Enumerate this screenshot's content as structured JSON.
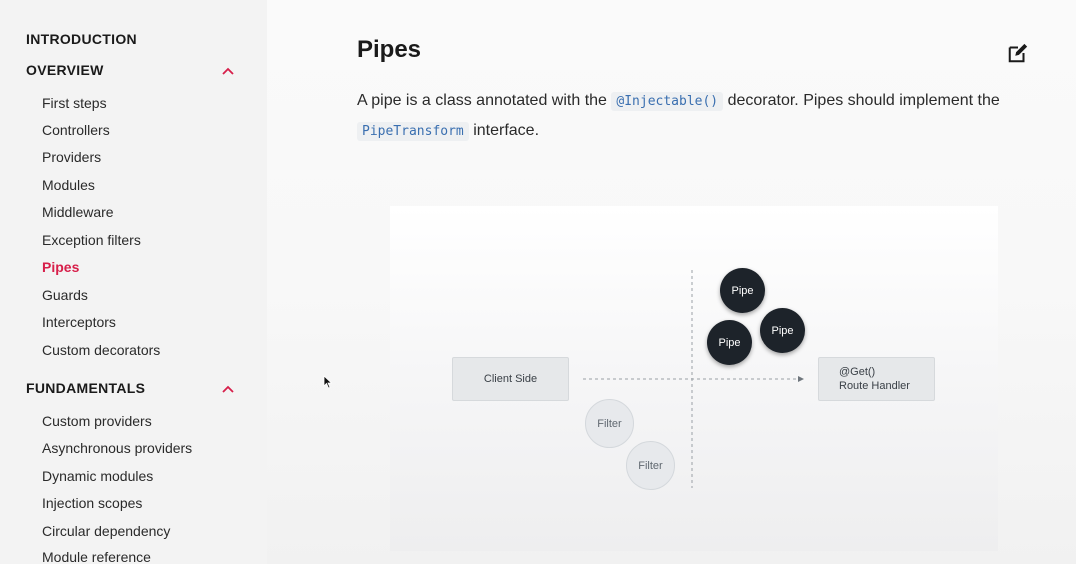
{
  "sidebar": {
    "introduction": "INTRODUCTION",
    "overview": {
      "title": "OVERVIEW",
      "items": [
        "First steps",
        "Controllers",
        "Providers",
        "Modules",
        "Middleware",
        "Exception filters",
        "Pipes",
        "Guards",
        "Interceptors",
        "Custom decorators"
      ],
      "active": "Pipes"
    },
    "fundamentals": {
      "title": "FUNDAMENTALS",
      "items": [
        "Custom providers",
        "Asynchronous providers",
        "Dynamic modules",
        "Injection scopes",
        "Circular dependency",
        "Module reference"
      ]
    }
  },
  "main": {
    "title": "Pipes",
    "desc_part1": "A pipe is a class annotated with the ",
    "code_injectable": "@Injectable()",
    "desc_part2": " decorator. Pipes should implement the ",
    "code_pipetransform": "PipeTransform",
    "desc_part3": " interface."
  },
  "diagram": {
    "client_side": "Client Side",
    "route_handler_line1": "@Get()",
    "route_handler_line2": "Route Handler",
    "pipe_label": "Pipe",
    "filter_label": "Filter"
  },
  "colors": {
    "accent": "#d71f4a",
    "pipe": "#1d232a",
    "code_text": "#3a6fb0"
  },
  "icons": {
    "edit": "edit-icon",
    "chevron": "chevron-up-icon"
  }
}
